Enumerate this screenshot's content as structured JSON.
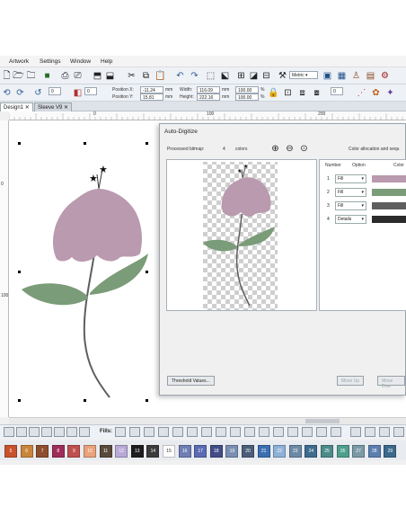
{
  "menu": [
    "Artwork",
    "Settings",
    "Window",
    "Help"
  ],
  "toolbar": {
    "position_x_label": "Position X:",
    "position_x_value": "-11.24",
    "position_y_label": "Position Y:",
    "position_y_value": "15.81",
    "width_label": "Width:",
    "width_value": "116.09",
    "height_label": "Height:",
    "height_value": "222.16",
    "unit": "mm",
    "scale_w": "100.00",
    "scale_h": "100.00",
    "percent": "%",
    "units_dropdown": "Metric",
    "rotate_value": "45",
    "step_value": "0"
  },
  "tabs": [
    "Design1",
    "Sleeve V9"
  ],
  "ruler": {
    "h_ticks": [
      "0",
      "100",
      "200"
    ],
    "v_ticks": [
      "0",
      "100"
    ]
  },
  "dialog": {
    "title": "Auto-Digitize",
    "processed_label": "Processed bitmap:",
    "processed_count": "4",
    "colors_label": "colors",
    "allocation_label": "Color allocation and sequ",
    "col_number": "Number",
    "col_option": "Option",
    "col_color": "Color",
    "rows": [
      {
        "n": "1",
        "option": "Fill",
        "color": "#b99aae"
      },
      {
        "n": "2",
        "option": "Fill",
        "color": "#7a9c78"
      },
      {
        "n": "3",
        "option": "Fill",
        "color": "#5e5e5e"
      },
      {
        "n": "4",
        "option": "Details",
        "color": "#2b2b2b"
      }
    ],
    "threshold_btn": "Threshold Values...",
    "move_up_btn": "Move Up",
    "move_down_btn": "Move Dow"
  },
  "stitch_bar": {
    "fills_label": "Fills:"
  },
  "palette": [
    {
      "n": "5",
      "color": "#c8522c"
    },
    {
      "n": "6",
      "color": "#c9863a"
    },
    {
      "n": "7",
      "color": "#8d4e2f"
    },
    {
      "n": "8",
      "color": "#9e2d5a"
    },
    {
      "n": "9",
      "color": "#c0504d"
    },
    {
      "n": "10",
      "color": "#e9a27a"
    },
    {
      "n": "11",
      "color": "#5a4a3a"
    },
    {
      "n": "12",
      "color": "#b9a9d6"
    },
    {
      "n": "13",
      "color": "#1d1d1d"
    },
    {
      "n": "14",
      "color": "#3c3c3c"
    },
    {
      "n": "15",
      "color": "#ffffff"
    },
    {
      "n": "16",
      "color": "#6f7fb5"
    },
    {
      "n": "17",
      "color": "#5b6bb4"
    },
    {
      "n": "18",
      "color": "#424c86"
    },
    {
      "n": "19",
      "color": "#7b8fb3"
    },
    {
      "n": "20",
      "color": "#4c5f7a"
    },
    {
      "n": "21",
      "color": "#3b6fb1"
    },
    {
      "n": "22",
      "color": "#8fb1d8"
    },
    {
      "n": "23",
      "color": "#6d8aa5"
    },
    {
      "n": "24",
      "color": "#3e6b8e"
    },
    {
      "n": "25",
      "color": "#4c8a8b"
    },
    {
      "n": "26",
      "color": "#4e9f8e"
    },
    {
      "n": "27",
      "color": "#7a9aa6"
    },
    {
      "n": "28",
      "color": "#5b7fb0"
    },
    {
      "n": "29",
      "color": "#3b6a8c"
    }
  ],
  "colors": {
    "flower": "#b99aae",
    "leaf": "#7a9c78",
    "stem": "#5e5e5e",
    "tab_active": "#ffffff"
  }
}
